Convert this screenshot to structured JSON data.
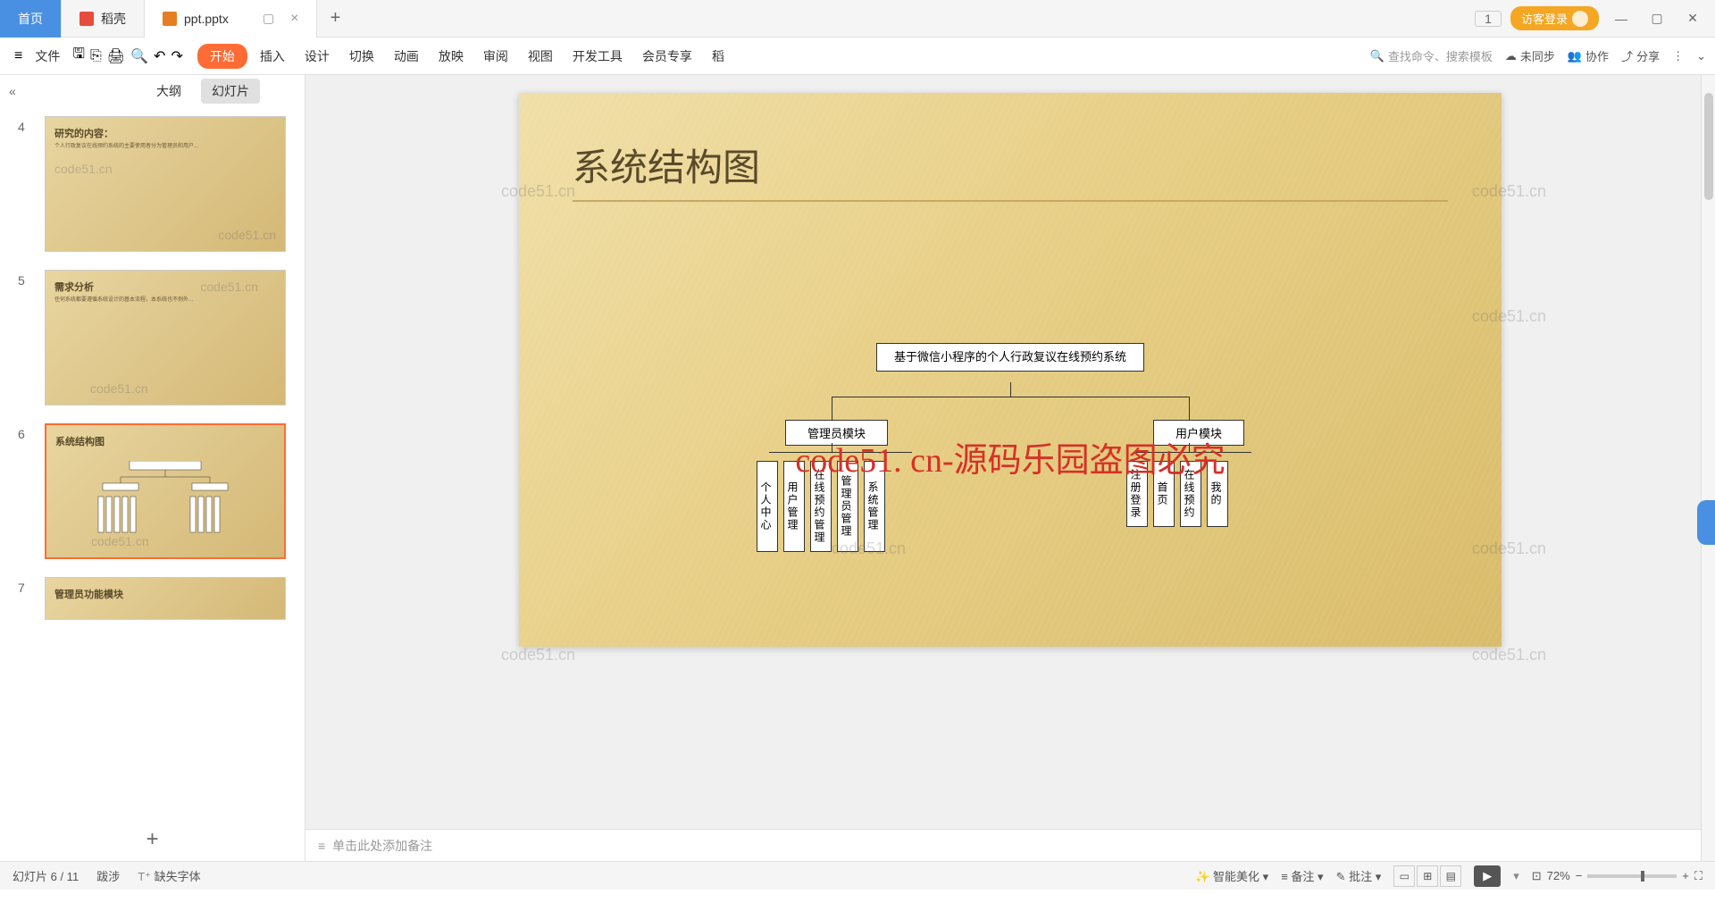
{
  "tabs": {
    "home": "首页",
    "daoke": "稻壳",
    "file": "ppt.pptx"
  },
  "titlebar": {
    "badge": "1",
    "login": "访客登录"
  },
  "ribbon": {
    "file": "文件",
    "menus": [
      "开始",
      "插入",
      "设计",
      "切换",
      "动画",
      "放映",
      "审阅",
      "视图",
      "开发工具",
      "会员专享",
      "稻"
    ],
    "search_placeholder": "查找命令、搜索模板",
    "unsync": "未同步",
    "collab": "协作",
    "share": "分享"
  },
  "sidebar": {
    "outline": "大纲",
    "slides": "幻灯片",
    "thumbs": [
      {
        "num": "4",
        "title": "研究的内容："
      },
      {
        "num": "5",
        "title": "需求分析"
      },
      {
        "num": "6",
        "title": "系统结构图"
      },
      {
        "num": "7",
        "title": "管理员功能模块"
      }
    ],
    "wm": "code51.cn"
  },
  "slide": {
    "title": "系统结构图",
    "overlay": "code51. cn-源码乐园盗图必究"
  },
  "chart_data": {
    "type": "tree",
    "root": "基于微信小程序的个人行政复议在线预约系统",
    "children": [
      {
        "name": "管理员模块",
        "children": [
          "个人中心",
          "用户管理",
          "在线预约管理",
          "管理员管理",
          "系统管理"
        ]
      },
      {
        "name": "用户模块",
        "children": [
          "注册登录",
          "首页",
          "在线预约",
          "我的"
        ]
      }
    ]
  },
  "watermarks": [
    "code51.cn",
    "code51.cn",
    "code51.cn",
    "code51.cn",
    "code51.cn",
    "code51.cn"
  ],
  "notes": {
    "placeholder": "单击此处添加备注"
  },
  "status": {
    "slide_pos": "幻灯片 6 / 11",
    "lang": "跋涉",
    "font_missing": "缺失字体",
    "beautify": "智能美化",
    "notes_btn": "备注",
    "comments": "批注",
    "zoom": "72%"
  }
}
